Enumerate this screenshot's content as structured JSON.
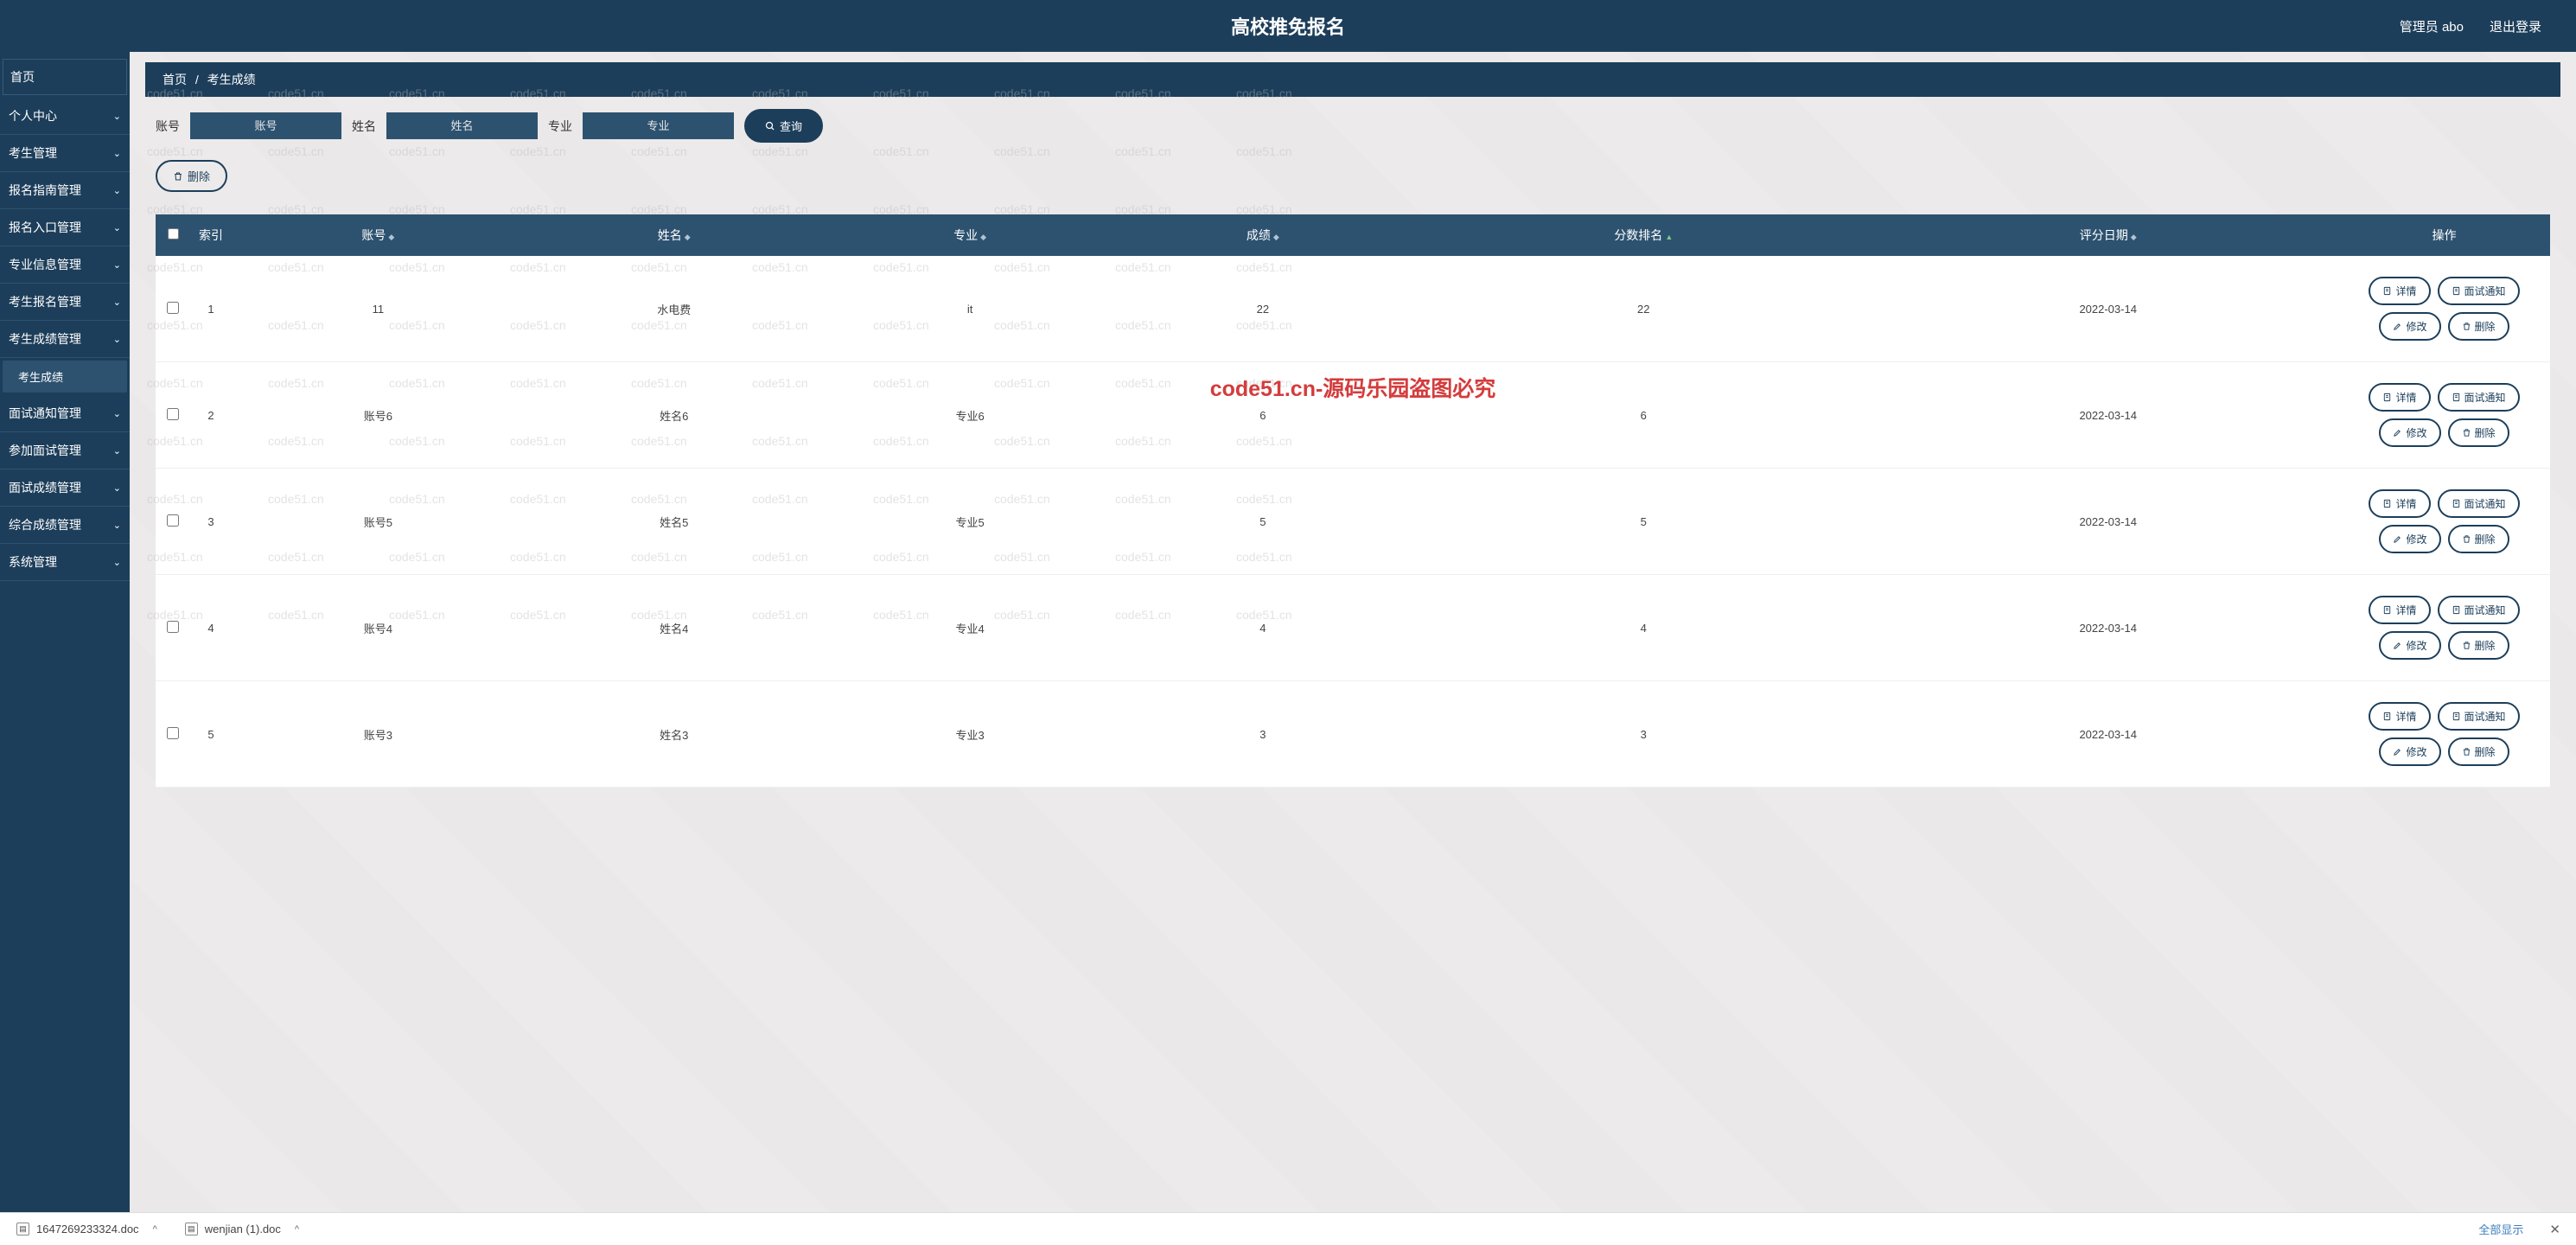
{
  "header": {
    "title": "高校推免报名",
    "admin_label": "管理员 abo",
    "logout_label": "退出登录"
  },
  "sidebar": {
    "home": "首页",
    "items": [
      {
        "label": "个人中心"
      },
      {
        "label": "考生管理"
      },
      {
        "label": "报名指南管理"
      },
      {
        "label": "报名入口管理"
      },
      {
        "label": "专业信息管理"
      },
      {
        "label": "考生报名管理"
      },
      {
        "label": "考生成绩管理",
        "sub": [
          {
            "label": "考生成绩"
          }
        ]
      },
      {
        "label": "面试通知管理"
      },
      {
        "label": "参加面试管理"
      },
      {
        "label": "面试成绩管理"
      },
      {
        "label": "综合成绩管理"
      },
      {
        "label": "系统管理"
      }
    ]
  },
  "breadcrumb": {
    "home": "首页",
    "sep": "/",
    "current": "考生成绩"
  },
  "search": {
    "account_label": "账号",
    "account_placeholder": "账号",
    "name_label": "姓名",
    "name_placeholder": "姓名",
    "major_label": "专业",
    "major_placeholder": "专业",
    "query_btn": "查询"
  },
  "bulk_delete": "删除",
  "columns": {
    "index": "索引",
    "account": "账号",
    "name": "姓名",
    "major": "专业",
    "score": "成绩",
    "rank": "分数排名",
    "date": "评分日期",
    "ops": "操作"
  },
  "op_labels": {
    "detail": "详情",
    "notify": "面试通知",
    "edit": "修改",
    "delete": "删除"
  },
  "rows": [
    {
      "index": "1",
      "account": "11",
      "name": "水电费",
      "major": "it",
      "score": "22",
      "rank": "22",
      "date": "2022-03-14"
    },
    {
      "index": "2",
      "account": "账号6",
      "name": "姓名6",
      "major": "专业6",
      "score": "6",
      "rank": "6",
      "date": "2022-03-14"
    },
    {
      "index": "3",
      "account": "账号5",
      "name": "姓名5",
      "major": "专业5",
      "score": "5",
      "rank": "5",
      "date": "2022-03-14"
    },
    {
      "index": "4",
      "account": "账号4",
      "name": "姓名4",
      "major": "专业4",
      "score": "4",
      "rank": "4",
      "date": "2022-03-14"
    },
    {
      "index": "5",
      "account": "账号3",
      "name": "姓名3",
      "major": "专业3",
      "score": "3",
      "rank": "3",
      "date": "2022-03-14"
    }
  ],
  "watermark": "code51.cn",
  "center_watermark": "code51.cn-源码乐园盗图必究",
  "downloads": {
    "file1": "1647269233324.doc",
    "file2": "wenjian (1).doc",
    "show_all": "全部显示"
  }
}
